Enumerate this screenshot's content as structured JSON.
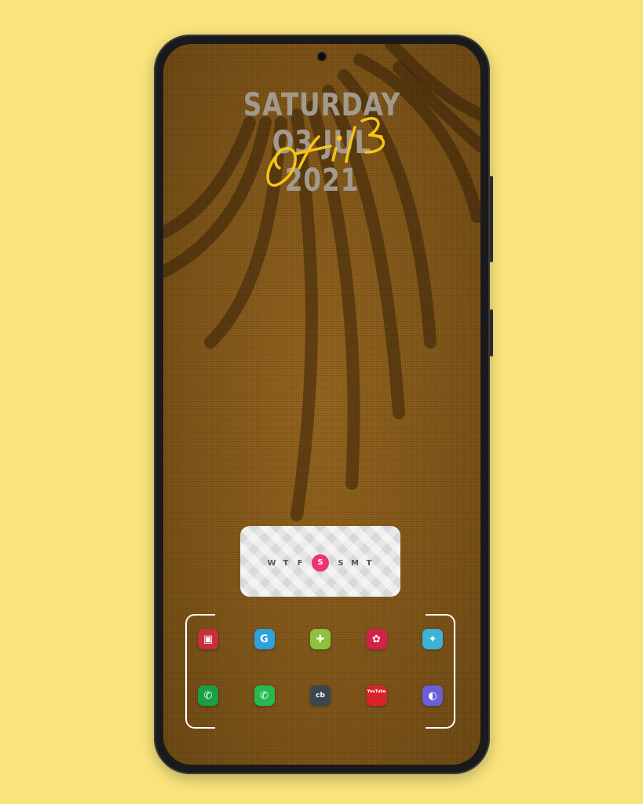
{
  "lockscreen": {
    "date_lines": [
      "SATURDAY",
      "O3 JUL",
      "2021"
    ],
    "signature_text": "Ofil3",
    "signature_color": "#f5c518"
  },
  "week_widget": {
    "days": [
      "W",
      "T",
      "F",
      "S",
      "S",
      "M",
      "T"
    ],
    "active_index": 3,
    "active_color": "#f0326e"
  },
  "dock": {
    "rows": [
      [
        {
          "name": "screen-recorder-icon",
          "bg": "#c62f3e",
          "glyph": "▣"
        },
        {
          "name": "google-translate-icon",
          "bg": "#2fa1de",
          "glyph": "G"
        },
        {
          "name": "gallery-icon",
          "bg": "#8cc23c",
          "glyph": "✚"
        },
        {
          "name": "flower-app-icon",
          "bg": "#d4214a",
          "glyph": "✿"
        },
        {
          "name": "bird-app-icon",
          "bg": "#3bb3d6",
          "glyph": "✦"
        }
      ],
      [
        {
          "name": "phone-icon",
          "bg": "#1a9e48",
          "glyph": "✆"
        },
        {
          "name": "whatsapp-icon",
          "bg": "#27b84f",
          "glyph": "✆"
        },
        {
          "name": "cb-app-icon",
          "bg": "#3c4650",
          "glyph": "cb"
        },
        {
          "name": "youtube-icon",
          "bg": "#d9222a",
          "glyph": "YouTube"
        },
        {
          "name": "browser-icon",
          "bg": "#6a5fd6",
          "glyph": "◐"
        }
      ]
    ]
  }
}
